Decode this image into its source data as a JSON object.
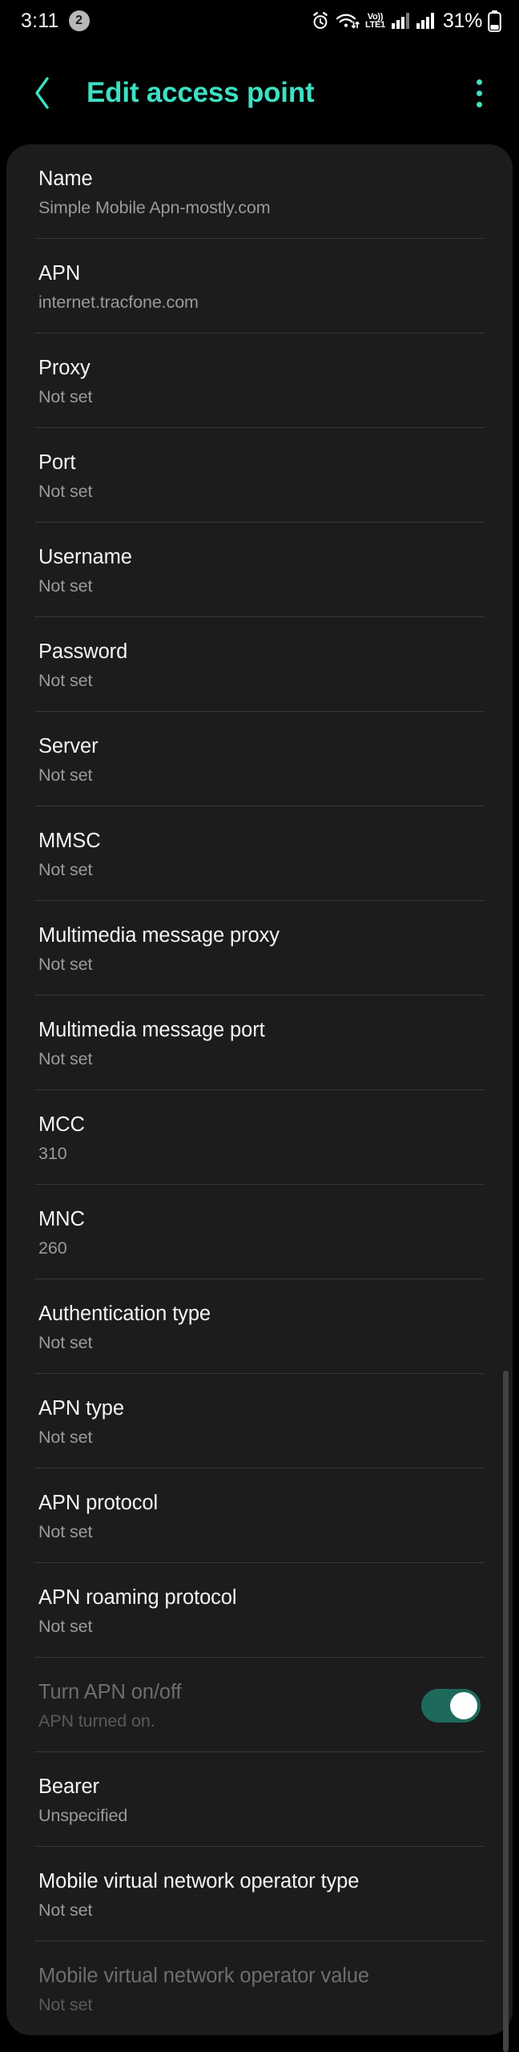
{
  "status_bar": {
    "time": "3:11",
    "notification_count": "2",
    "icons": [
      "alarm-icon",
      "wifi-icon",
      "volte-icon",
      "signal-bars-icon",
      "signal-bars-icon",
      "battery-icon"
    ],
    "volte_top": "Vo))",
    "volte_bottom": "LTE1",
    "battery_percent": "31%"
  },
  "app_bar": {
    "title": "Edit access point",
    "back_icon": "back-chevron-icon",
    "overflow_icon": "more-vert-icon",
    "accent_color": "#3ee0c4"
  },
  "settings": {
    "items": [
      {
        "title": "Name",
        "value": "Simple Mobile Apn-mostly.com",
        "type": "text",
        "disabled": false
      },
      {
        "title": "APN",
        "value": "internet.tracfone.com",
        "type": "text",
        "disabled": false
      },
      {
        "title": "Proxy",
        "value": "Not set",
        "type": "text",
        "disabled": false
      },
      {
        "title": "Port",
        "value": "Not set",
        "type": "text",
        "disabled": false
      },
      {
        "title": "Username",
        "value": "Not set",
        "type": "text",
        "disabled": false
      },
      {
        "title": "Password",
        "value": "Not set",
        "type": "text",
        "disabled": false
      },
      {
        "title": "Server",
        "value": "Not set",
        "type": "text",
        "disabled": false
      },
      {
        "title": "MMSC",
        "value": "Not set",
        "type": "text",
        "disabled": false
      },
      {
        "title": "Multimedia message proxy",
        "value": "Not set",
        "type": "text",
        "disabled": false
      },
      {
        "title": "Multimedia message port",
        "value": "Not set",
        "type": "text",
        "disabled": false
      },
      {
        "title": "MCC",
        "value": "310",
        "type": "text",
        "disabled": false
      },
      {
        "title": "MNC",
        "value": "260",
        "type": "text",
        "disabled": false
      },
      {
        "title": "Authentication type",
        "value": "Not set",
        "type": "text",
        "disabled": false
      },
      {
        "title": "APN type",
        "value": "Not set",
        "type": "text",
        "disabled": false
      },
      {
        "title": "APN protocol",
        "value": "Not set",
        "type": "text",
        "disabled": false
      },
      {
        "title": "APN roaming protocol",
        "value": "Not set",
        "type": "text",
        "disabled": false
      },
      {
        "title": "Turn APN on/off",
        "value": "APN turned on.",
        "type": "switch",
        "switch_on": true,
        "disabled": true
      },
      {
        "title": "Bearer",
        "value": "Unspecified",
        "type": "text",
        "disabled": false
      },
      {
        "title": "Mobile virtual network operator type",
        "value": "Not set",
        "type": "text",
        "disabled": false
      },
      {
        "title": "Mobile virtual network operator value",
        "value": "Not set",
        "type": "text",
        "disabled": true
      }
    ]
  },
  "colors": {
    "background": "#000000",
    "card": "#1c1c1c",
    "accent": "#3ee0c4",
    "switch_on": "#1d6a5c",
    "divider": "#373737"
  }
}
